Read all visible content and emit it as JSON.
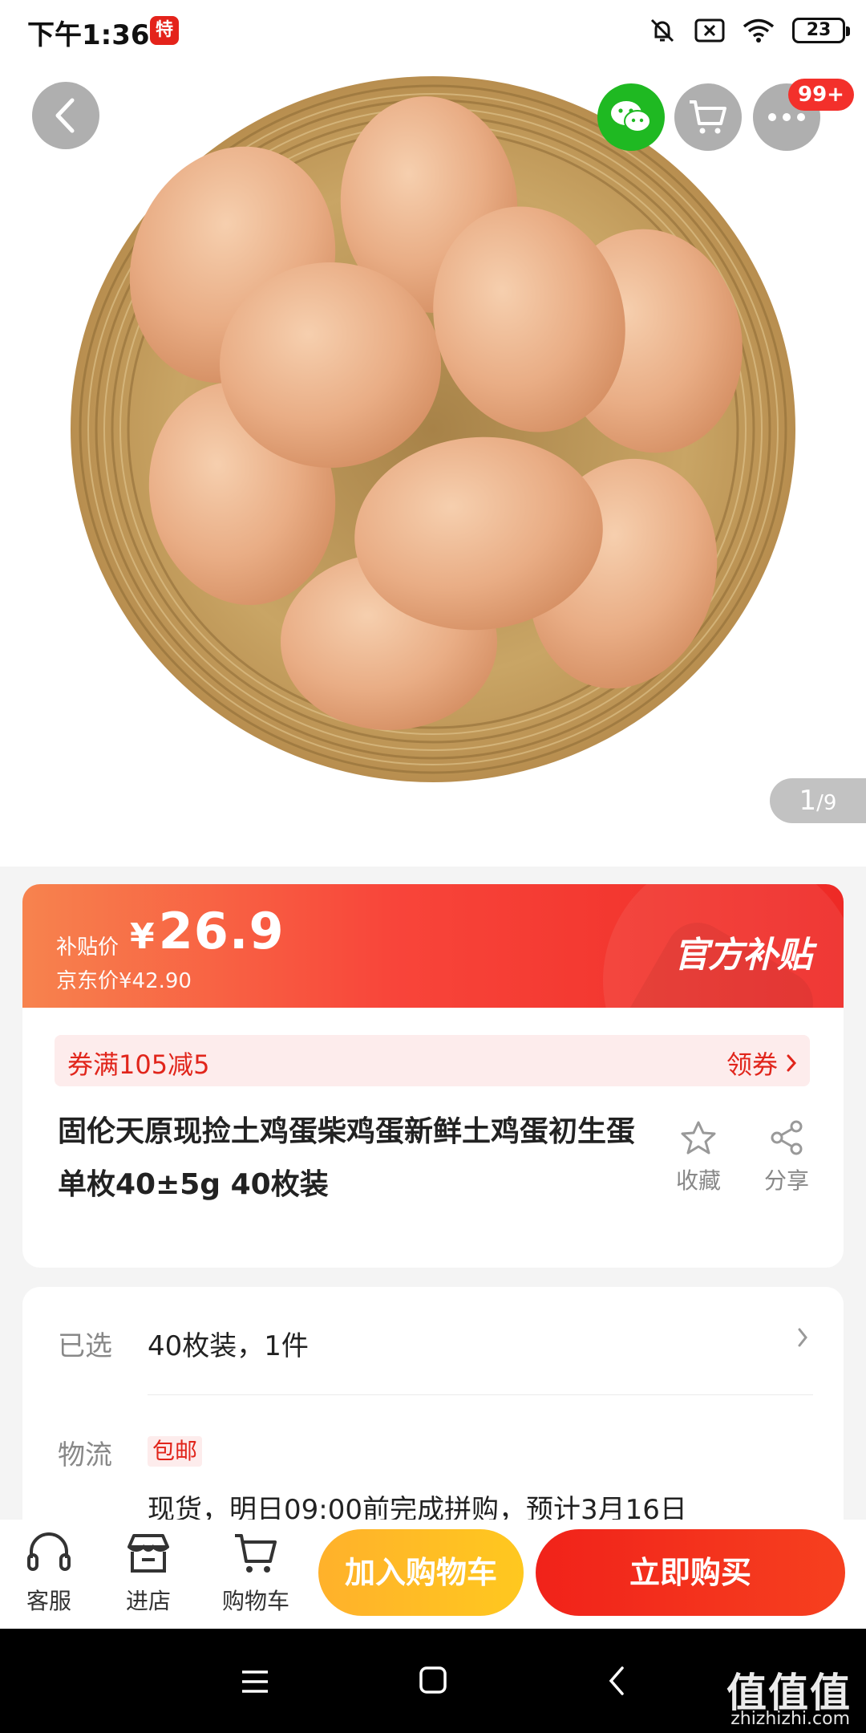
{
  "status_bar": {
    "time": "下午1:36",
    "app_icon_char": "特",
    "battery": "23"
  },
  "hero": {
    "page_current": "1",
    "page_total": "/9",
    "cart_badge": "99+"
  },
  "price": {
    "label": "补贴价",
    "currency": "¥",
    "amount": "26.9",
    "original": "京东价¥42.90",
    "tag": "官方补贴"
  },
  "coupon": {
    "text": "券满105减5",
    "link": "领券"
  },
  "product": {
    "title": "固伦天原现捡土鸡蛋柴鸡蛋新鲜土鸡蛋初生蛋单枚40±5g 40枚装",
    "favorite_label": "收藏",
    "share_label": "分享"
  },
  "spec": {
    "selected_label": "已选",
    "selected_value": "40枚装，1件",
    "logistics_label": "物流",
    "free_shipping_tag": "包邮",
    "logistics_value": "现货，明日09:00前完成拼购，预计3月16日"
  },
  "bottom_bar": {
    "service_label": "客服",
    "store_label": "进店",
    "cart_label": "购物车",
    "add_to_cart": "加入购物车",
    "buy_now": "立即购买"
  },
  "watermark": {
    "text": "值值值",
    "url": "zhizhizhi.com"
  }
}
